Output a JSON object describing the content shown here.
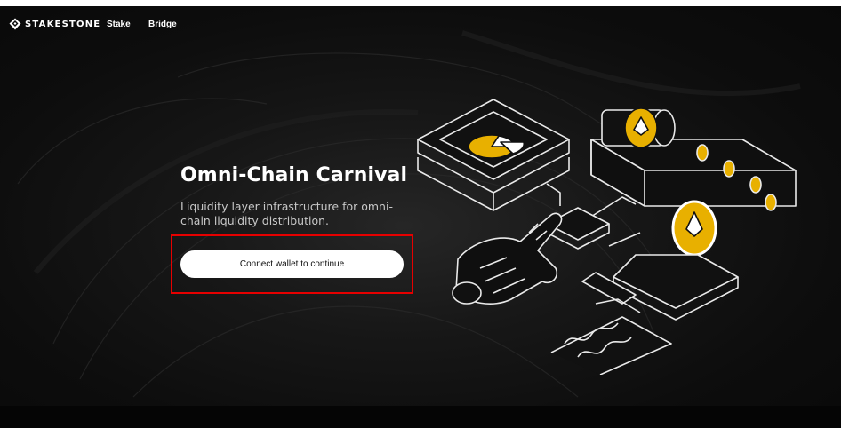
{
  "header": {
    "logo_text": "STAKESTONE",
    "nav": [
      {
        "label": "Stake"
      },
      {
        "label": "Bridge"
      }
    ]
  },
  "hero": {
    "title": "Omni-Chain Carnival",
    "subtitle": "Liquidity layer infrastructure for omni-chain liquidity distribution.",
    "cta_label": "Connect wallet to continue"
  },
  "colors": {
    "background": "#0b0b0b",
    "accent": "#e8b000",
    "highlight_border": "#e60000",
    "button_bg": "#ffffff"
  }
}
